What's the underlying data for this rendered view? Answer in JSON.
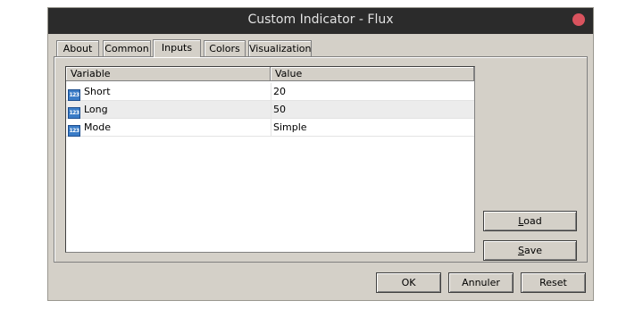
{
  "window": {
    "title": "Custom Indicator - Flux"
  },
  "tabs": [
    {
      "label": "About"
    },
    {
      "label": "Common"
    },
    {
      "label": "Inputs",
      "active": true
    },
    {
      "label": "Colors"
    },
    {
      "label": "Visualization"
    }
  ],
  "grid": {
    "columns": [
      "Variable",
      "Value"
    ],
    "rows": [
      {
        "variable": "Short",
        "value": "20",
        "icon": "numeric-123-icon"
      },
      {
        "variable": "Long",
        "value": "50",
        "icon": "numeric-123-icon"
      },
      {
        "variable": "Mode",
        "value": "Simple",
        "icon": "numeric-123-icon"
      }
    ],
    "icon_text": "123"
  },
  "side_buttons": {
    "load": "Load",
    "save": "Save"
  },
  "footer": {
    "ok": "OK",
    "cancel": "Annuler",
    "reset": "Reset"
  },
  "colors": {
    "titlebar": "#2b2b2b",
    "close": "#d9535e",
    "dialog": "#d4d0c8"
  }
}
